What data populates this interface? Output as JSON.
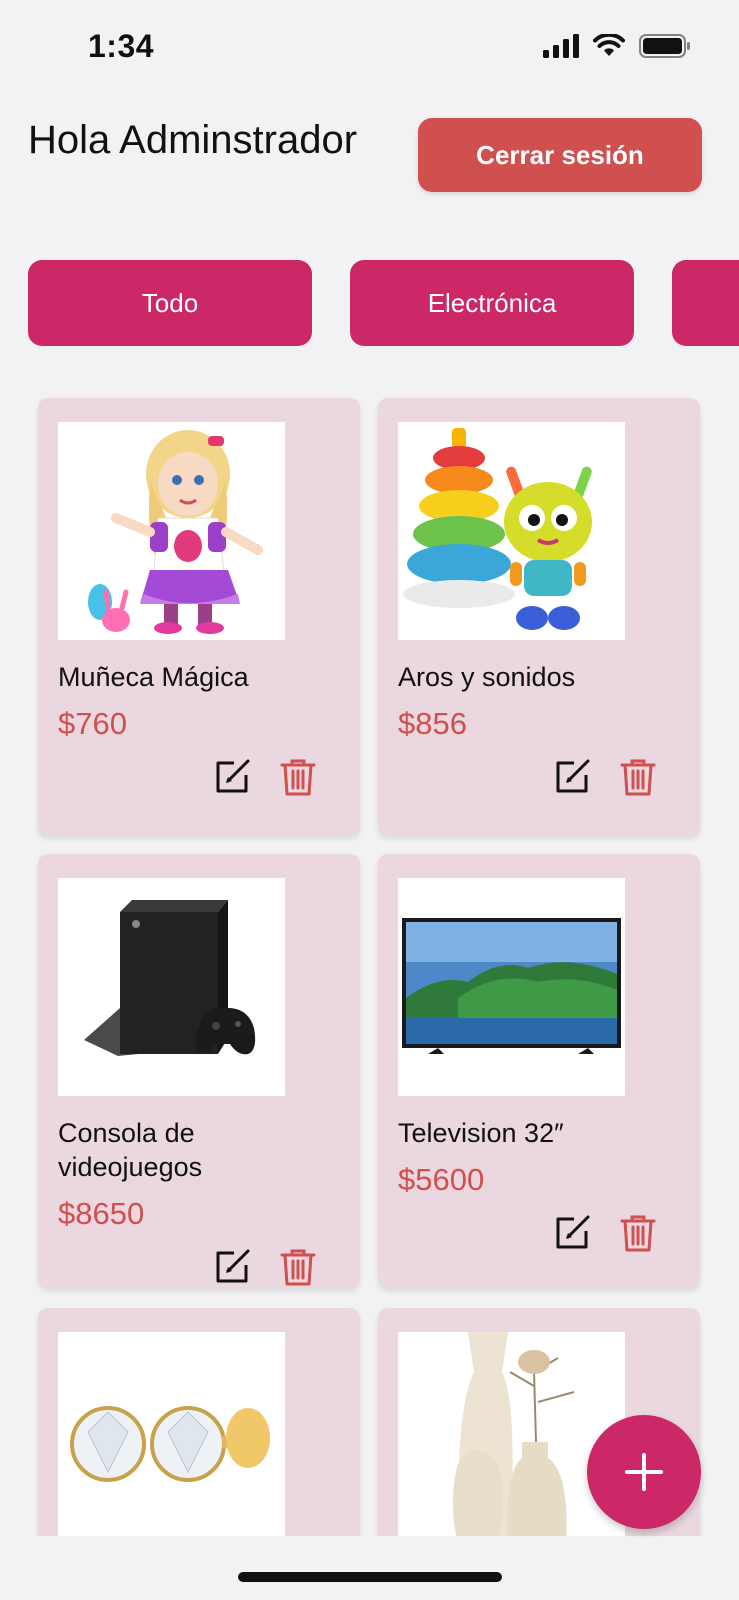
{
  "status_bar": {
    "time": "1:34"
  },
  "header": {
    "greeting": "Hola Adminstrador",
    "logout_label": "Cerrar sesión"
  },
  "categories": [
    {
      "label": "Todo"
    },
    {
      "label": "Electrónica"
    },
    {
      "label": ""
    }
  ],
  "products": [
    {
      "name": "Muñeca Mágica",
      "price": "$760",
      "image": "doll"
    },
    {
      "name": "Aros y sonidos",
      "price": "$856",
      "image": "stacking-rings-toy"
    },
    {
      "name": "Consola de videojuegos",
      "price": "$8650",
      "image": "game-console"
    },
    {
      "name": "Television 32″",
      "price": "$5600",
      "image": "television"
    },
    {
      "name": "",
      "price": "",
      "image": "earrings"
    },
    {
      "name": "",
      "price": "",
      "image": "vases"
    }
  ],
  "colors": {
    "primary": "#cc2766",
    "danger": "#d05050",
    "card_bg": "#ead7e0",
    "page_bg": "#f2f2f4"
  },
  "icons": {
    "edit": "edit-icon",
    "delete": "trash-icon",
    "add": "plus-icon"
  }
}
